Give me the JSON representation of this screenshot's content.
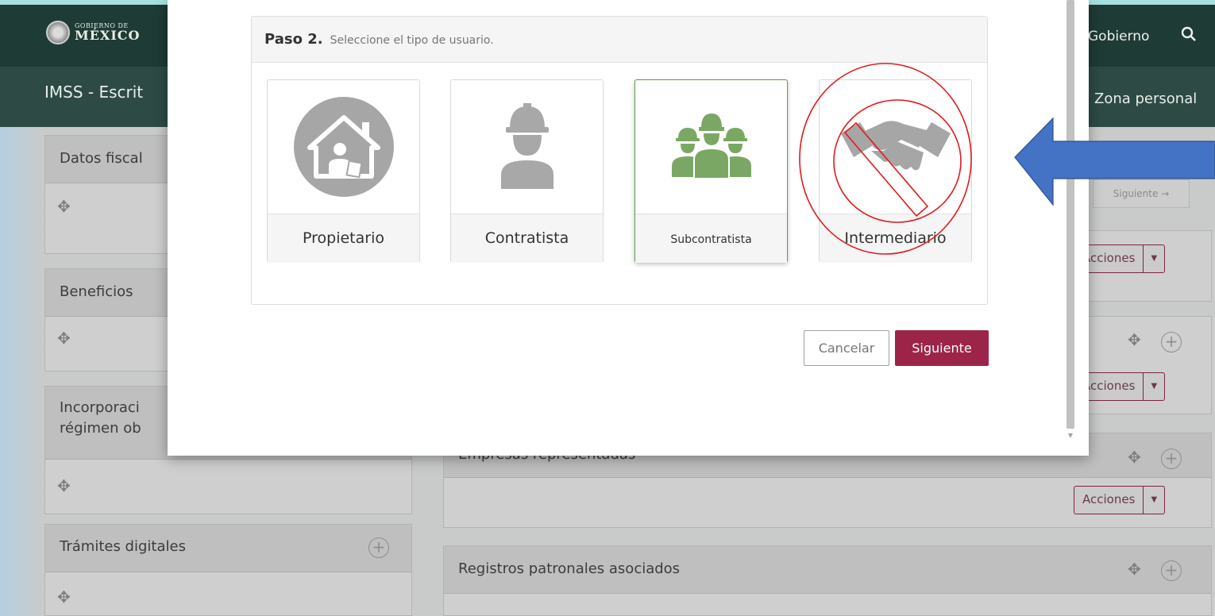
{
  "header": {
    "logo_small": "GOBIERNO DE",
    "logo_big": "MÉXICO",
    "nav_gobierno": "Gobierno",
    "sub_title": "IMSS - Escrit",
    "zona_personal": "Zona personal"
  },
  "background": {
    "panels_left": [
      {
        "title": "Datos fiscal"
      },
      {
        "title": "Beneficios"
      },
      {
        "title": "Incorporaci\nrégimen ob"
      },
      {
        "title": "Trámites digitales"
      }
    ],
    "panels_right": [
      {
        "title": "Empresas representadas"
      },
      {
        "title": "Registros patronales asociados"
      }
    ],
    "acciones_label": "Acciones",
    "siguiente_small": "Siguiente →"
  },
  "modal": {
    "step_number": "Paso 2.",
    "step_text": "Seleccione el tipo de usuario.",
    "options": [
      {
        "label": "Propietario",
        "icon": "owner-house-icon",
        "selected": false
      },
      {
        "label": "Contratista",
        "icon": "worker-icon",
        "selected": false
      },
      {
        "label": "Subcontratista",
        "icon": "worker-group-icon",
        "selected": true
      },
      {
        "label": "Intermediario",
        "icon": "handshake-icon",
        "selected": false
      }
    ],
    "cancel_label": "Cancelar",
    "next_label": "Siguiente"
  },
  "colors": {
    "brand_primary": "#9d2449",
    "header_bg": "#1f3b35",
    "selected_green": "#7aa864",
    "annotation_red": "#e01b1b",
    "annotation_arrow": "#4472c4"
  }
}
